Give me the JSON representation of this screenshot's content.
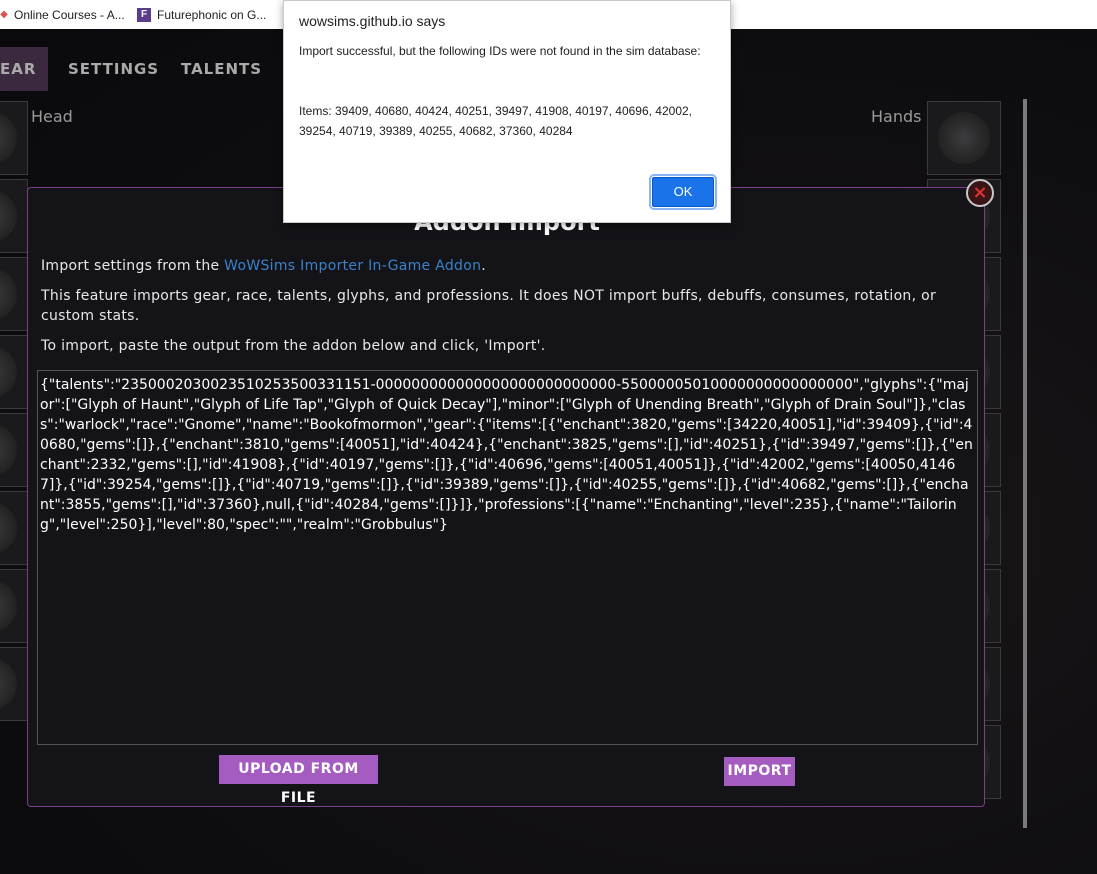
{
  "bookmarks": [
    {
      "label": "Online Courses - A..."
    },
    {
      "label": "Futurephonic on G..."
    }
  ],
  "nav": {
    "gear": "EAR",
    "settings": "SETTINGS",
    "talents": "TALENTS"
  },
  "slots": {
    "head": "Head",
    "hands": "Hands"
  },
  "modal": {
    "title": "Addon Import",
    "close_icon": "×",
    "p1_prefix": "Import settings from the ",
    "p1_link": "WoWSims Importer In-Game Addon",
    "p1_suffix": ".",
    "p2": "This feature imports gear, race, talents, glyphs, and professions. It does NOT import buffs, debuffs, consumes, rotation, or custom stats.",
    "p3": "To import, paste the output from the addon below and click, 'Import'.",
    "import_text": "{\"talents\":\"2350002030023510253500331151-000000000000000000000000000-55000005010000000000000000\",\"glyphs\":{\"major\":[\"Glyph of Haunt\",\"Glyph of Life Tap\",\"Glyph of Quick Decay\"],\"minor\":[\"Glyph of Unending Breath\",\"Glyph of Drain Soul\"]},\"class\":\"warlock\",\"race\":\"Gnome\",\"name\":\"Bookofmormon\",\"gear\":{\"items\":[{\"enchant\":3820,\"gems\":[34220,40051],\"id\":39409},{\"id\":40680,\"gems\":[]},{\"enchant\":3810,\"gems\":[40051],\"id\":40424},{\"enchant\":3825,\"gems\":[],\"id\":40251},{\"id\":39497,\"gems\":[]},{\"enchant\":2332,\"gems\":[],\"id\":41908},{\"id\":40197,\"gems\":[]},{\"id\":40696,\"gems\":[40051,40051]},{\"id\":42002,\"gems\":[40050,41467]},{\"id\":39254,\"gems\":[]},{\"id\":40719,\"gems\":[]},{\"id\":39389,\"gems\":[]},{\"id\":40255,\"gems\":[]},{\"id\":40682,\"gems\":[]},{\"enchant\":3855,\"gems\":[],\"id\":37360},null,{\"id\":40284,\"gems\":[]}]},\"professions\":[{\"name\":\"Enchanting\",\"level\":235},{\"name\":\"Tailoring\",\"level\":250}],\"level\":80,\"spec\":\"\",\"realm\":\"Grobbulus\"}",
    "upload_label": "UPLOAD FROM FILE",
    "import_label": "IMPORT"
  },
  "alert": {
    "title": "wowsims.github.io says",
    "message": "Import successful, but the following IDs were not found in the sim database:",
    "items": "Items: 39409, 40680, 40424, 40251, 39497, 41908, 40197, 40696, 42002, 39254, 40719, 39389, 40255, 40682, 37360, 40284",
    "ok_label": "OK"
  },
  "colors": {
    "accent_purple": "#a45cc1",
    "modal_border": "#7a3f8a",
    "link_blue": "#3b82c9",
    "alert_button": "#1a73e8"
  }
}
